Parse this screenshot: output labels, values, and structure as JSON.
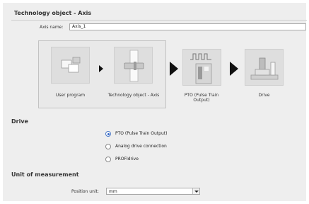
{
  "header": {
    "title": "Technology object - Axis"
  },
  "axis": {
    "label": "Axis name:",
    "value": "Axis_1"
  },
  "diagram": {
    "items": [
      {
        "label": "User program",
        "icon": "program-blocks-icon"
      },
      {
        "label": "Technology object - Axis",
        "icon": "axis-object-icon"
      },
      {
        "label": "PTO (Pulse Train Output)",
        "icon": "pulse-train-icon"
      },
      {
        "label": "Drive",
        "icon": "drive-motor-icon"
      }
    ]
  },
  "drive": {
    "title": "Drive",
    "options": [
      {
        "label": "PTO (Pulse Train Output)",
        "selected": true
      },
      {
        "label": "Analog drive connection",
        "selected": false
      },
      {
        "label": "PROFIdrive",
        "selected": false
      }
    ]
  },
  "unit": {
    "title": "Unit of measurement",
    "position_label": "Position unit:",
    "position_value": "mm"
  },
  "colors": {
    "panel": "#eeeeee",
    "accent": "#2f64c6",
    "arrow": "#111111"
  }
}
